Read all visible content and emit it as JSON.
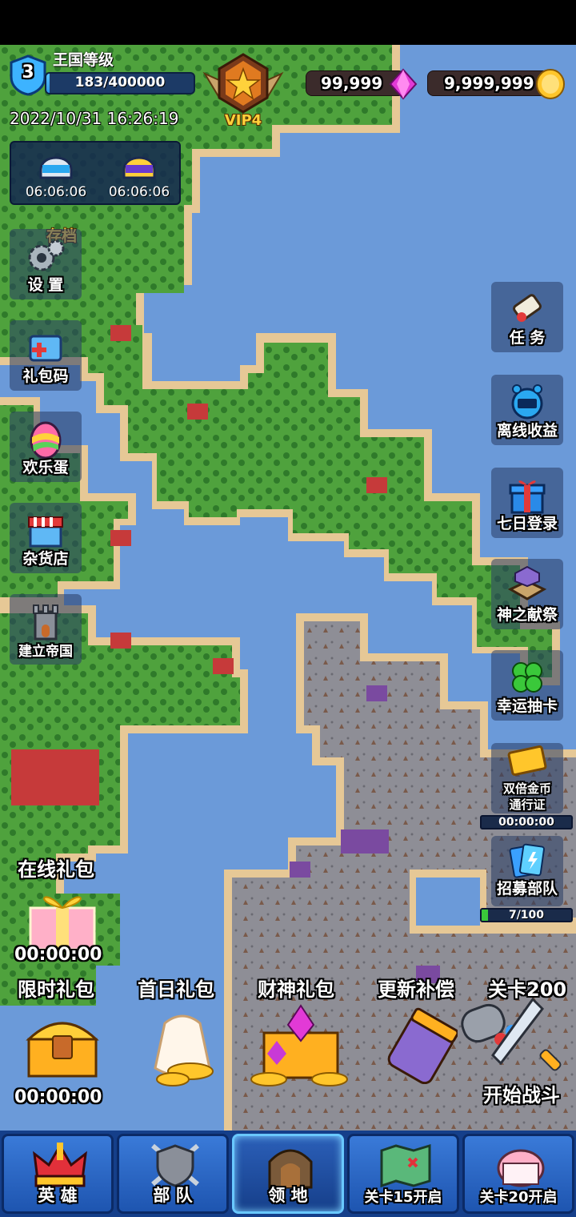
{
  "header": {
    "kingdom_level": "3",
    "kingdom_title": "王国等级",
    "exp_text": "183/400000",
    "exp_fraction": 0.0005,
    "vip_label": "VIP4",
    "datetime": "2022/10/31 16:26:19",
    "gems": "99,999",
    "gold": "9,999,999"
  },
  "timers": [
    {
      "icon": "helmet-blue-icon",
      "value": "06:06:06"
    },
    {
      "icon": "helmet-gold-icon",
      "value": "06:06:06"
    }
  ],
  "left_menu": {
    "save_label": "存档",
    "settings_label": "设 置",
    "gift_code_label": "礼包码",
    "happy_egg_label": "欢乐蛋",
    "shop_label": "杂货店",
    "empire_label": "建立帝国"
  },
  "right_menu": {
    "task_label": "任 务",
    "offline_label": "离线收益",
    "seven_day_label": "七日登录",
    "offering_label": "神之献祭",
    "lucky_label": "幸运抽卡",
    "double_gold_label_1": "双倍金币",
    "double_gold_label_2": "通行证",
    "double_gold_timer": "00:00:00",
    "recruit_label": "招募部队",
    "recruit_progress": "7/100",
    "recruit_fraction": 0.07
  },
  "gifts": {
    "online_label": "在线礼包",
    "online_timer": "00:00:00",
    "limited_label": "限时礼包",
    "limited_timer": "00:00:00",
    "first_day_label": "首日礼包",
    "wealth_label": "财神礼包",
    "update_label": "更新补偿",
    "stage_label": "关卡200",
    "battle_label": "开始战斗"
  },
  "nav": {
    "hero": "英 雄",
    "troops": "部 队",
    "territory": "领 地",
    "stage15": "关卡15开启",
    "stage20": "关卡20开启"
  },
  "colors": {
    "ocean": "#6b9ad9",
    "grass": "#4fa23d",
    "sand": "#e6c896",
    "rock": "#8e8e96",
    "nav_blue": "#1e55b0"
  }
}
